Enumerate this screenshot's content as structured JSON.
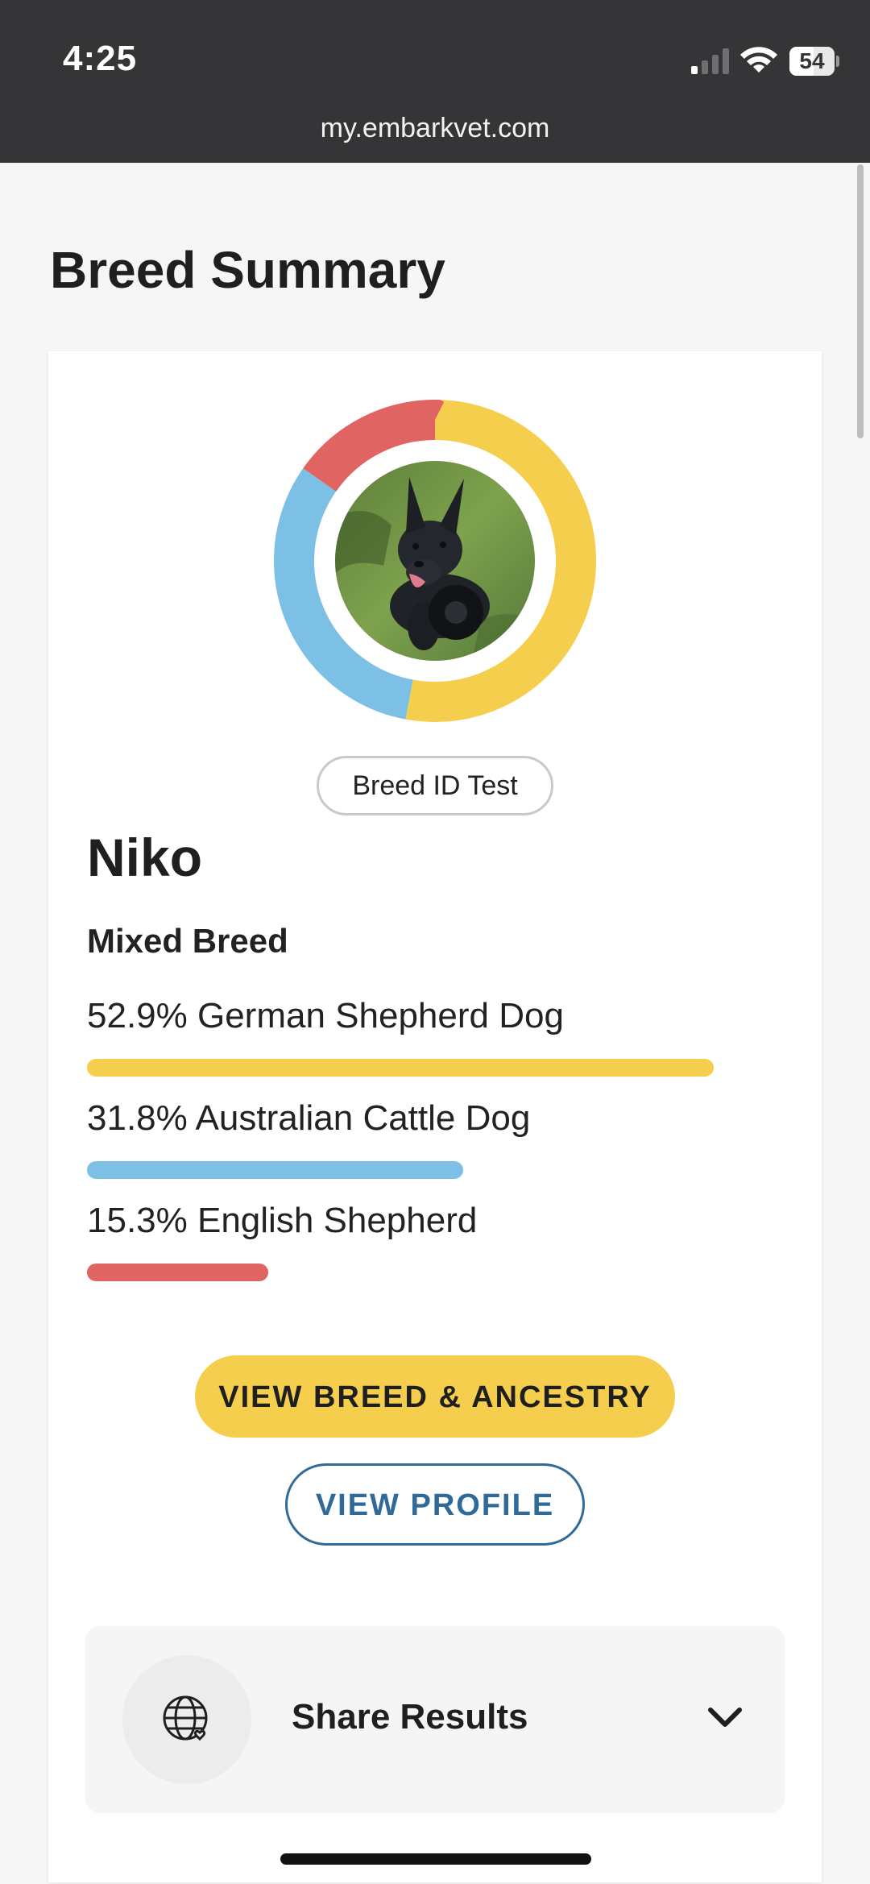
{
  "status_bar": {
    "time": "4:25",
    "battery_level": "54",
    "battery_fraction": 0.54,
    "signal_bars_active": 1
  },
  "browser": {
    "url": "my.embarkvet.com"
  },
  "page": {
    "title": "Breed Summary"
  },
  "dog": {
    "test_badge": "Breed ID Test",
    "name": "Niko",
    "breed_type": "Mixed Breed",
    "breeds": [
      {
        "label": "52.9% German Shepherd Dog",
        "percent": 52.9,
        "color": "#f6ce4e"
      },
      {
        "label": "31.8% Australian Cattle Dog",
        "percent": 31.8,
        "color": "#7dc0e6"
      },
      {
        "label": "15.3% English Shepherd",
        "percent": 15.3,
        "color": "#e06462"
      }
    ]
  },
  "actions": {
    "view_breed_ancestry": "VIEW BREED & ANCESTRY",
    "view_profile": "VIEW PROFILE"
  },
  "share": {
    "label": "Share Results",
    "icon": "globe-icon",
    "toggle_icon": "chevron-down-icon"
  },
  "colors": {
    "chrome_background": "#353537",
    "primary_yellow": "#f6ce4e",
    "profile_blue": "#2f6a99"
  }
}
